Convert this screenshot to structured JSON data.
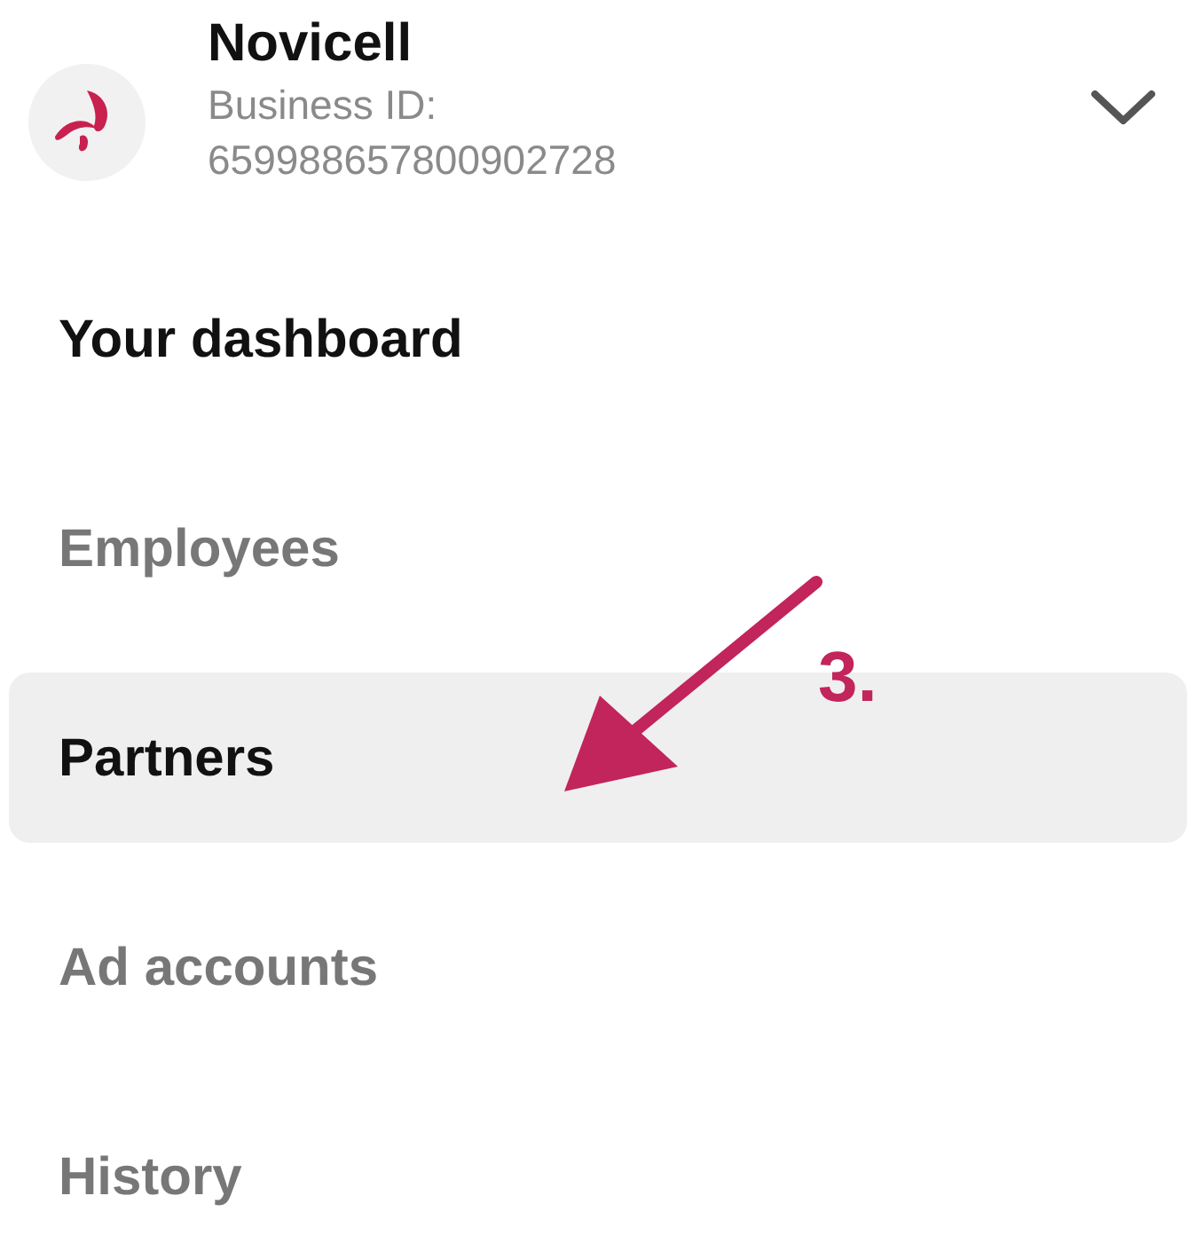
{
  "account": {
    "name": "Novicell",
    "id_label": "Business ID:",
    "id_value": "659988657800902728"
  },
  "menu": [
    {
      "label": "Your dashboard",
      "kind": "heading",
      "selected": false
    },
    {
      "label": "Employees",
      "kind": "link",
      "selected": false
    },
    {
      "label": "Partners",
      "kind": "link",
      "selected": true
    },
    {
      "label": "Ad accounts",
      "kind": "link",
      "selected": false
    },
    {
      "label": "History",
      "kind": "link",
      "selected": false
    }
  ],
  "annotation": {
    "label": "3."
  }
}
